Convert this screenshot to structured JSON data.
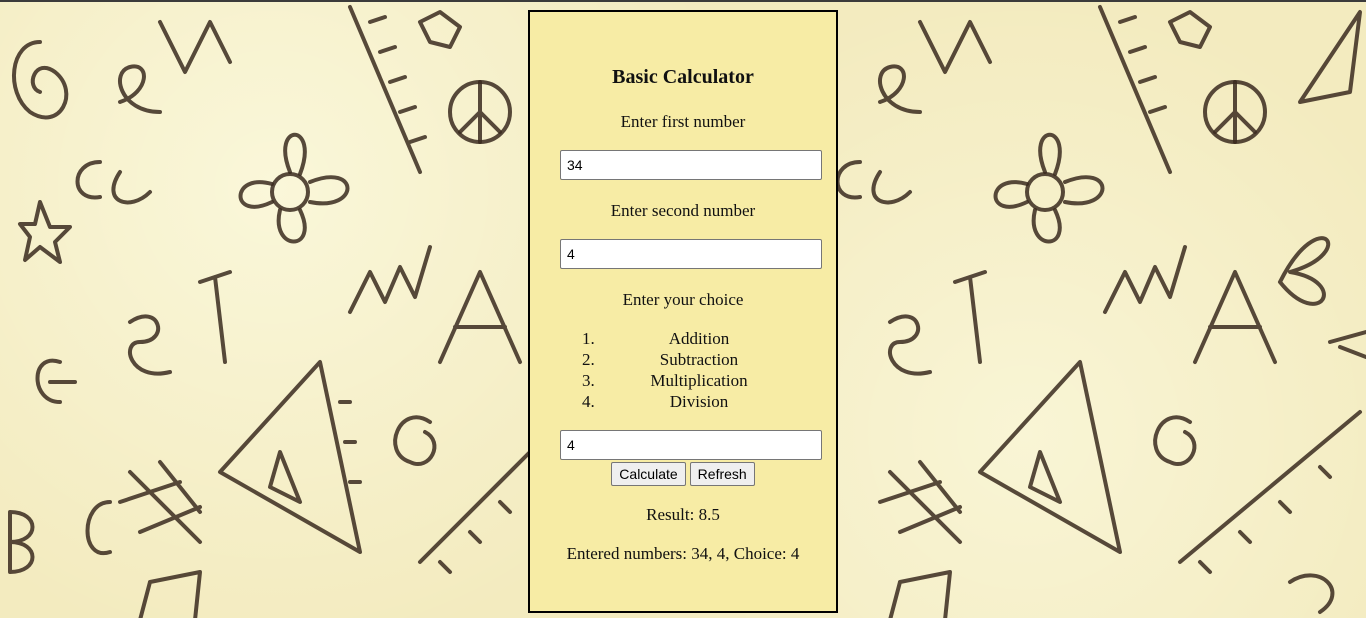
{
  "calculator": {
    "title": "Basic Calculator",
    "first_label": "Enter first number",
    "first_value": "34",
    "second_label": "Enter second number",
    "second_value": "4",
    "choice_label": "Enter your choice",
    "options": [
      {
        "num": "1.",
        "label": "Addition"
      },
      {
        "num": "2.",
        "label": "Subtraction"
      },
      {
        "num": "3.",
        "label": "Multiplication"
      },
      {
        "num": "4.",
        "label": "Division"
      }
    ],
    "choice_value": "4",
    "calculate_label": "Calculate",
    "refresh_label": "Refresh",
    "result_text": "Result: 8.5",
    "entered_text": "Entered numbers: 34, 4, Choice: 4"
  },
  "colors": {
    "card_bg": "#f7eca5",
    "page_bg": "#f3ebbf",
    "doodle": "#3a2a1e"
  }
}
